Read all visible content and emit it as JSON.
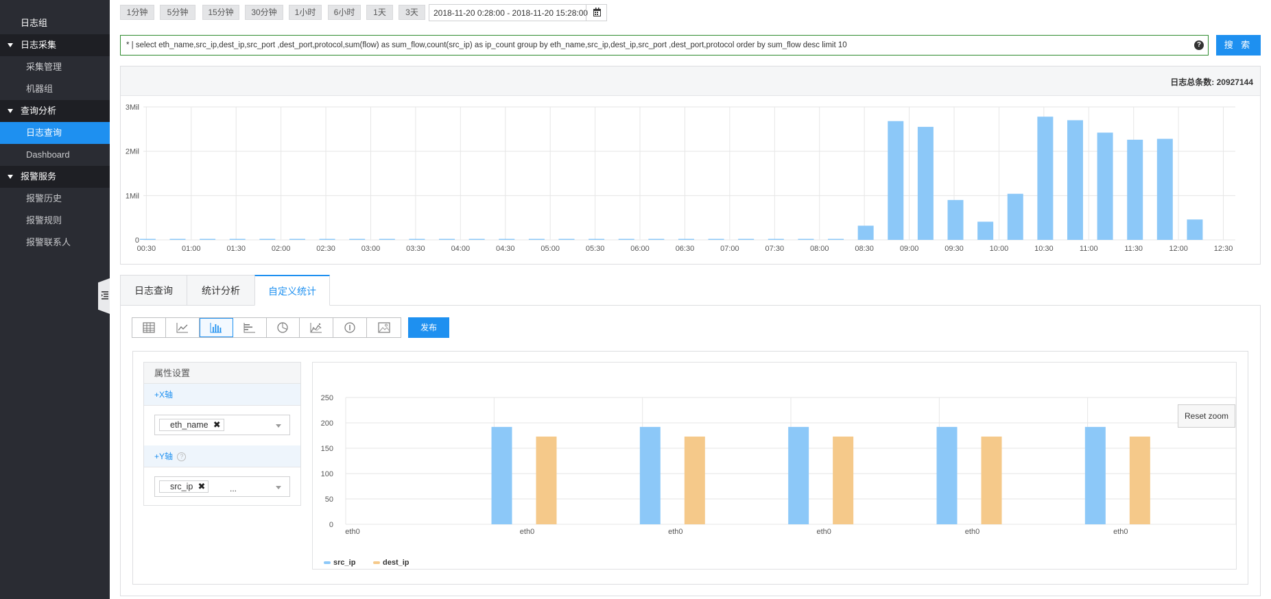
{
  "sidebar": {
    "items": [
      {
        "label": "日志组",
        "kind": "top"
      },
      {
        "label": "日志采集",
        "kind": "group"
      },
      {
        "label": "采集管理",
        "kind": "sub"
      },
      {
        "label": "机器组",
        "kind": "sub"
      },
      {
        "label": "查询分析",
        "kind": "group"
      },
      {
        "label": "日志查询",
        "kind": "sub",
        "active": true
      },
      {
        "label": "Dashboard",
        "kind": "sub"
      },
      {
        "label": "报警服务",
        "kind": "group"
      },
      {
        "label": "报警历史",
        "kind": "sub"
      },
      {
        "label": "报警规则",
        "kind": "sub"
      },
      {
        "label": "报警联系人",
        "kind": "sub"
      }
    ]
  },
  "time_bar": {
    "buttons": [
      "1分钟",
      "5分钟",
      "15分钟",
      "30分钟",
      "1小时",
      "6小时",
      "1天",
      "3天"
    ],
    "date_range": "2018-11-20 0:28:00 - 2018-11-20 15:28:00"
  },
  "query": {
    "text": "* | select eth_name,src_ip,dest_ip,src_port ,dest_port,protocol,sum(flow) as sum_flow,count(src_ip) as ip_count group by eth_name,src_ip,dest_ip,src_port ,dest_port,protocol order by sum_flow desc limit 10",
    "help": "?",
    "search_label": "搜 索"
  },
  "histogram": {
    "total_label": "日志总条数:",
    "total_value": "20927144",
    "chart_data": {
      "type": "bar",
      "y_ticks": [
        "0",
        "1Mil",
        "2Mil",
        "3Mil"
      ],
      "ylim": [
        0,
        3000000
      ],
      "x_ticks": [
        "00:30",
        "01:00",
        "01:30",
        "02:00",
        "02:30",
        "03:00",
        "03:30",
        "04:00",
        "04:30",
        "05:00",
        "05:30",
        "06:00",
        "06:30",
        "07:00",
        "07:30",
        "08:00",
        "08:30",
        "09:00",
        "09:30",
        "10:00",
        "10:30",
        "11:00",
        "11:30",
        "12:00",
        "12:30"
      ],
      "values": [
        5000,
        5000,
        5000,
        5000,
        5000,
        5000,
        5000,
        5000,
        5000,
        5000,
        5000,
        5000,
        5000,
        5000,
        5000,
        5000,
        5000,
        5000,
        5000,
        5000,
        5000,
        5000,
        5000,
        5000,
        5000,
        5000,
        5000,
        5000,
        5000,
        5000,
        5000,
        5000,
        5000,
        5000,
        5000,
        5000,
        5000,
        5000,
        5000,
        5000,
        5000,
        5000,
        5000,
        5000,
        5000,
        5000,
        5000,
        5000,
        5000,
        5000,
        5000,
        5000,
        5000,
        5000,
        5000,
        5000,
        5000,
        5000,
        5000,
        5000,
        5000,
        5000,
        5000,
        5000,
        5000,
        5000,
        5000,
        5000,
        5000,
        5000,
        5000,
        5000,
        5000,
        5000,
        5000,
        5000,
        5000,
        5000,
        5000,
        5000,
        5000,
        5000,
        5000,
        5000,
        5000,
        5000,
        5000,
        5000,
        5000,
        5000,
        5000,
        5000,
        5000,
        5000,
        5000,
        5000,
        5000,
        5000,
        5000,
        5000,
        5000,
        5000,
        5000,
        5000,
        5000,
        5000,
        5000,
        5000,
        5000,
        5000,
        5000,
        5000,
        5000,
        5000,
        5000,
        5000,
        5000,
        5000,
        5000,
        5000,
        5000,
        5000,
        5000,
        5000,
        5000,
        5000,
        5000,
        5000,
        5000,
        5000,
        5000,
        5000,
        5000,
        5000,
        5000,
        5000,
        5000,
        5000,
        5000,
        5000,
        5000,
        5000,
        5000,
        5000,
        5000,
        5000,
        5000,
        5000,
        5000,
        5000,
        5000,
        5000,
        5000,
        5000,
        5000,
        5000,
        5000,
        5000,
        5000,
        5000,
        5000,
        5000
      ],
      "bars": [
        {
          "t": "00:30",
          "v": 5000
        },
        {
          "t": "00:50",
          "v": 5000
        },
        {
          "t": "01:10",
          "v": 5000
        },
        {
          "t": "01:30",
          "v": 5000
        },
        {
          "t": "01:50",
          "v": 5000
        },
        {
          "t": "02:10",
          "v": 5000
        },
        {
          "t": "02:30",
          "v": 5000
        },
        {
          "t": "02:50",
          "v": 5000
        },
        {
          "t": "03:10",
          "v": 5000
        },
        {
          "t": "03:30",
          "v": 5000
        },
        {
          "t": "03:50",
          "v": 5000
        },
        {
          "t": "04:10",
          "v": 5000
        },
        {
          "t": "04:30",
          "v": 5000
        },
        {
          "t": "04:50",
          "v": 5000
        },
        {
          "t": "05:10",
          "v": 5000
        },
        {
          "t": "05:30",
          "v": 5000
        },
        {
          "t": "05:50",
          "v": 5000
        },
        {
          "t": "06:10",
          "v": 5000
        },
        {
          "t": "06:30",
          "v": 5000
        },
        {
          "t": "06:50",
          "v": 5000
        },
        {
          "t": "07:10",
          "v": 5000
        },
        {
          "t": "07:30",
          "v": 5000
        },
        {
          "t": "07:50",
          "v": 5000
        },
        {
          "t": "08:10",
          "v": 5000
        },
        {
          "t": "08:30",
          "v": 320000
        },
        {
          "t": "08:50",
          "v": 2680000
        },
        {
          "t": "09:10",
          "v": 2550000
        },
        {
          "t": "09:30",
          "v": 900000
        },
        {
          "t": "09:50",
          "v": 410000
        },
        {
          "t": "10:10",
          "v": 1040000
        },
        {
          "t": "10:30",
          "v": 2780000
        },
        {
          "t": "10:50",
          "v": 2700000
        },
        {
          "t": "11:10",
          "v": 2420000
        },
        {
          "t": "11:30",
          "v": 2260000
        },
        {
          "t": "11:50",
          "v": 2280000
        },
        {
          "t": "12:10",
          "v": 460000
        }
      ],
      "color": "#8cc8f8",
      "grid": true
    }
  },
  "tabs": [
    {
      "label": "日志查询",
      "active": false
    },
    {
      "label": "统计分析",
      "active": false
    },
    {
      "label": "自定义统计",
      "active": true
    }
  ],
  "chart_types": [
    {
      "icon": "table-icon"
    },
    {
      "icon": "line-chart-icon"
    },
    {
      "icon": "bar-chart-icon",
      "active": true
    },
    {
      "icon": "horizontal-bar-icon"
    },
    {
      "icon": "pie-chart-icon"
    },
    {
      "icon": "area-chart-icon"
    },
    {
      "icon": "single-value-icon"
    },
    {
      "icon": "map-icon"
    }
  ],
  "publish_label": "发布",
  "attr_panel": {
    "title": "属性设置",
    "x_axis_label": "+X轴",
    "x_value": "eth_name",
    "y_axis_label": "+Y轴",
    "y_help": "?",
    "y_value": "src_ip",
    "y_more": "..."
  },
  "reset_zoom": "Reset zoom",
  "custom_chart": {
    "chart_data": {
      "type": "bar",
      "categories": [
        "eth0",
        "eth0",
        "eth0",
        "eth0",
        "eth0",
        "eth0"
      ],
      "series": [
        {
          "name": "src_ip",
          "color": "#8cc8f8",
          "values": [
            0,
            192,
            192,
            192,
            192,
            192
          ]
        },
        {
          "name": "dest_ip",
          "color": "#f5c98a",
          "values": [
            0,
            173,
            173,
            173,
            173,
            173
          ]
        }
      ],
      "y_ticks": [
        0,
        50,
        100,
        150,
        200,
        250
      ],
      "ylim": [
        0,
        250
      ],
      "grid": true,
      "legend": "bottom-left"
    }
  }
}
